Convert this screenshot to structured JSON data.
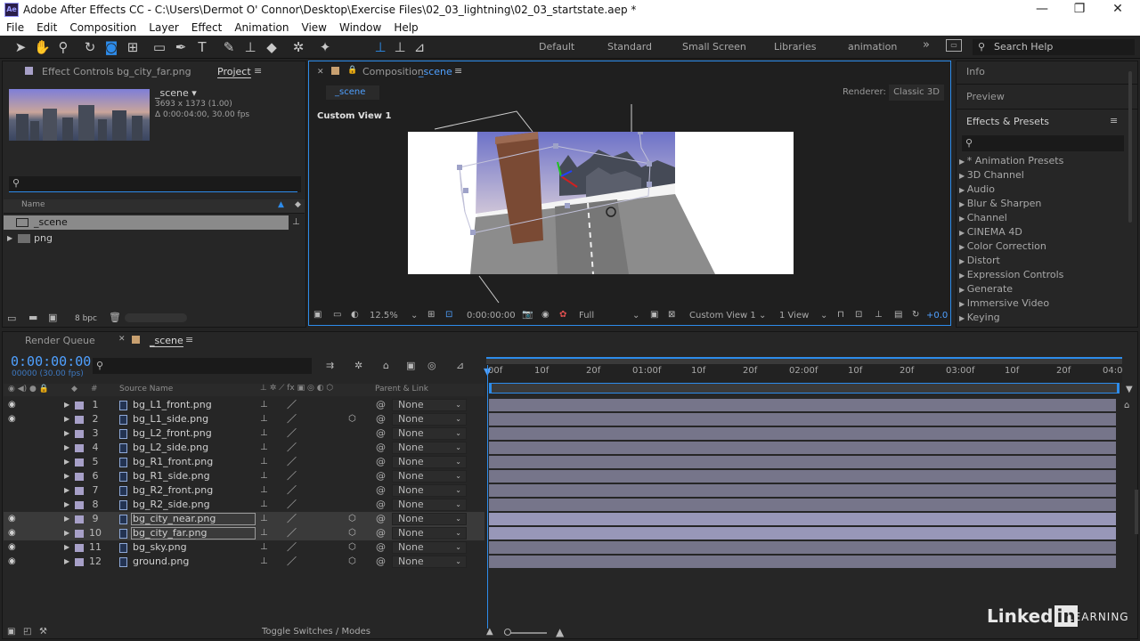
{
  "app": {
    "title": "Adobe After Effects CC  -  C:\\Users\\Dermot O' Connor\\Desktop\\Exercise Files\\02_03_lightning\\02_03_startstate.aep *",
    "icon_text": "Ae"
  },
  "menu": [
    "File",
    "Edit",
    "Composition",
    "Layer",
    "Effect",
    "Animation",
    "View",
    "Window",
    "Help"
  ],
  "workspaces": [
    "Default",
    "Standard",
    "Small Screen",
    "Libraries",
    "animation"
  ],
  "search_help": "Search Help",
  "left_panel": {
    "tab_effect_controls": "Effect Controls bg_city_far.png",
    "tab_project": "Project",
    "item_name": "_scene ▾",
    "item_dims": "3693 x 1373 (1.00)",
    "item_duration": "Δ 0:00:04:00, 30.00 fps",
    "col_name": "Name",
    "rows": [
      "_scene",
      "png"
    ],
    "bpc": "8 bpc"
  },
  "comp": {
    "tab": "Composition",
    "tab_name": "_scene",
    "subtab": "_scene",
    "renderer_label": "Renderer:",
    "renderer": "Classic 3D",
    "view_label": "Custom View 1",
    "zoom": "12.5%",
    "time": "0:00:00:00",
    "quality": "Full",
    "view_select": "Custom View 1",
    "views": "1 View",
    "exposure": "+0.0"
  },
  "right_panel": {
    "info": "Info",
    "preview": "Preview",
    "effects_presets": "Effects & Presets",
    "items": [
      "* Animation Presets",
      "3D Channel",
      "Audio",
      "Blur & Sharpen",
      "Channel",
      "CINEMA 4D",
      "Color Correction",
      "Distort",
      "Expression Controls",
      "Generate",
      "Immersive Video",
      "Keying"
    ]
  },
  "timeline": {
    "render_queue": "Render Queue",
    "comp_tab": "_scene",
    "timecode": "0:00:00:00",
    "timecode_sub": "00000 (30.00 fps)",
    "col_source": "Source Name",
    "col_parent": "Parent & Link",
    "col_hash": "#",
    "toggle": "Toggle Switches / Modes",
    "ruler": [
      "00f",
      "10f",
      "20f",
      "01:00f",
      "10f",
      "20f",
      "02:00f",
      "10f",
      "20f",
      "03:00f",
      "10f",
      "20f",
      "04:0"
    ],
    "layers": [
      {
        "num": "1",
        "name": "bg_L1_front.png",
        "parent": "None"
      },
      {
        "num": "2",
        "name": "bg_L1_side.png",
        "parent": "None"
      },
      {
        "num": "3",
        "name": "bg_L2_front.png",
        "parent": "None"
      },
      {
        "num": "4",
        "name": "bg_L2_side.png",
        "parent": "None"
      },
      {
        "num": "5",
        "name": "bg_R1_front.png",
        "parent": "None"
      },
      {
        "num": "6",
        "name": "bg_R1_side.png",
        "parent": "None"
      },
      {
        "num": "7",
        "name": "bg_R2_front.png",
        "parent": "None"
      },
      {
        "num": "8",
        "name": "bg_R2_side.png",
        "parent": "None"
      },
      {
        "num": "9",
        "name": "bg_city_near.png",
        "parent": "None"
      },
      {
        "num": "10",
        "name": "bg_city_far.png",
        "parent": "None"
      },
      {
        "num": "11",
        "name": "bg_sky.png",
        "parent": "None"
      },
      {
        "num": "12",
        "name": "ground.png",
        "parent": "None"
      }
    ]
  },
  "watermark": {
    "brand": "Linked",
    "in": "in",
    "learning": "LEARNING"
  }
}
